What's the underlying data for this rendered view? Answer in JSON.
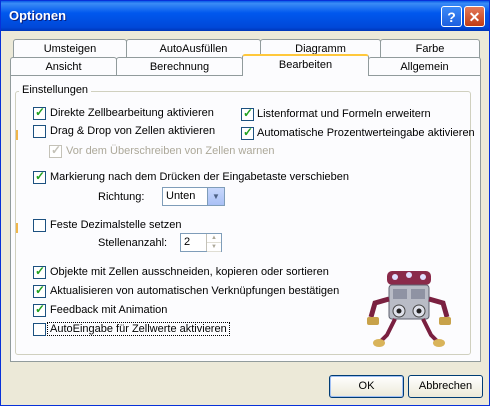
{
  "window": {
    "title": "Optionen"
  },
  "titlebar": {
    "help_glyph": "?",
    "close_glyph": "✕"
  },
  "tabs": {
    "row1": [
      "Umsteigen",
      "AutoAusfüllen",
      "Diagramm",
      "Farbe"
    ],
    "row2": [
      "Ansicht",
      "Berechnung",
      "Bearbeiten",
      "Allgemein"
    ],
    "active": "Bearbeiten"
  },
  "group": {
    "label": "Einstellungen"
  },
  "options": {
    "direkte_zellbearbeitung": {
      "label": "Direkte Zellbearbeitung aktivieren",
      "checked": true
    },
    "listenformat": {
      "label": "Listenformat und Formeln erweitern",
      "checked": true
    },
    "drag_drop": {
      "label": "Drag & Drop von Zellen aktivieren",
      "checked": false
    },
    "prozentwerteingabe": {
      "label": "Automatische Prozentwerteingabe aktivieren",
      "checked": true
    },
    "ueberschreiben_warnen": {
      "label": "Vor dem Überschreiben von Zellen warnen",
      "checked": true,
      "disabled": true
    },
    "markierung_verschieben": {
      "label": "Markierung nach dem Drücken der Eingabetaste verschieben",
      "checked": true
    },
    "richtung": {
      "label": "Richtung:",
      "value": "Unten"
    },
    "feste_dezimalstelle": {
      "label": "Feste Dezimalstelle setzen",
      "checked": false
    },
    "stellenanzahl": {
      "label": "Stellenanzahl:",
      "value": "2"
    },
    "objekte_ausschneiden": {
      "label": "Objekte mit Zellen ausschneiden, kopieren oder sortieren",
      "checked": true
    },
    "verknuepfungen": {
      "label": "Aktualisieren von automatischen Verknüpfungen bestätigen",
      "checked": true
    },
    "feedback_animation": {
      "label": "Feedback mit Animation",
      "checked": true
    },
    "autoeingabe": {
      "label": "AutoEingabe für Zellwerte aktivieren",
      "checked": false
    }
  },
  "buttons": {
    "ok": "OK",
    "cancel": "Abbrechen"
  },
  "icons": {
    "mascot": "office-assistant-robot-icon",
    "help": "help-icon",
    "close": "close-icon"
  }
}
